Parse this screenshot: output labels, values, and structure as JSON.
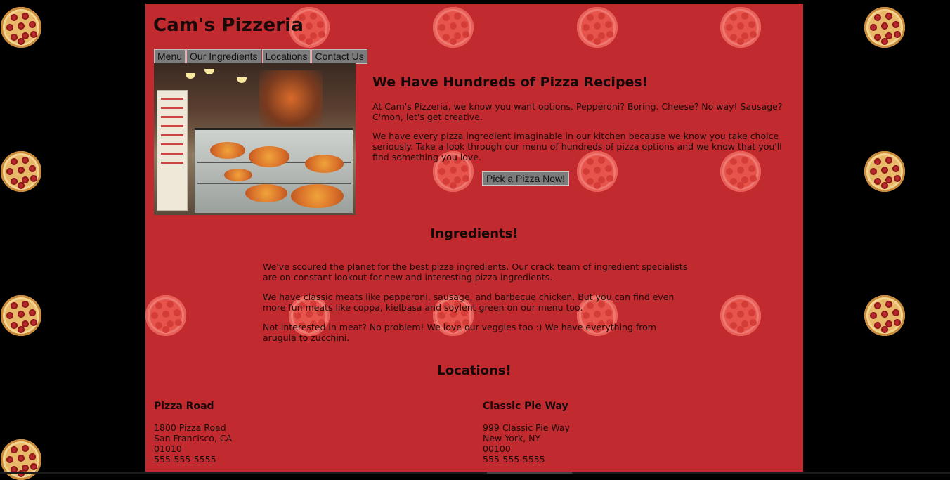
{
  "site": {
    "title": "Cam's Pizzeria"
  },
  "nav": {
    "items": [
      "Menu",
      "Our Ingredients",
      "Locations",
      "Contact Us"
    ]
  },
  "hero": {
    "heading": "We Have Hundreds of Pizza Recipes!",
    "paragraphs": [
      "At Cam's Pizzeria, we know you want options. Pepperoni? Boring. Cheese? No way! Sausage? C'mon, let's get creative.",
      "We have every pizza ingredient imaginable in our kitchen because we know you take choice seriously. Take a look through our menu of hundreds of pizza options and we know that you'll find something you love."
    ],
    "button_label": "Pick a Pizza Now!"
  },
  "ingredients": {
    "heading": "Ingredients!",
    "paragraphs": [
      "We've scoured the planet for the best pizza ingredients. Our crack team of ingredient specialists are on constant lookout for new and interesting pizza ingredients.",
      "We have classic meats like pepperoni, sausage, and barbecue chicken. But you can find even more fun meats like coppa, kielbasa and soylent green on our menu too.",
      "Not interested in meat? No problem! We love our veggies too :) We have everything from arugula to zucchini."
    ]
  },
  "locations": {
    "heading": "Locations!",
    "items": [
      {
        "name": "Pizza Road",
        "street": "1800 Pizza Road",
        "city": "San Francisco, CA",
        "zip": "01010",
        "phone": "555-555-5555"
      },
      {
        "name": "Classic Pie Way",
        "street": "999 Classic Pie Way",
        "city": "New York, NY",
        "zip": "00100",
        "phone": "555-555-5555"
      }
    ]
  },
  "colors": {
    "page_background": "#c12b2f",
    "body_background": "#000000",
    "button_background": "#7b7b7b"
  },
  "icons": {
    "background_pattern": "pizza-icon"
  }
}
